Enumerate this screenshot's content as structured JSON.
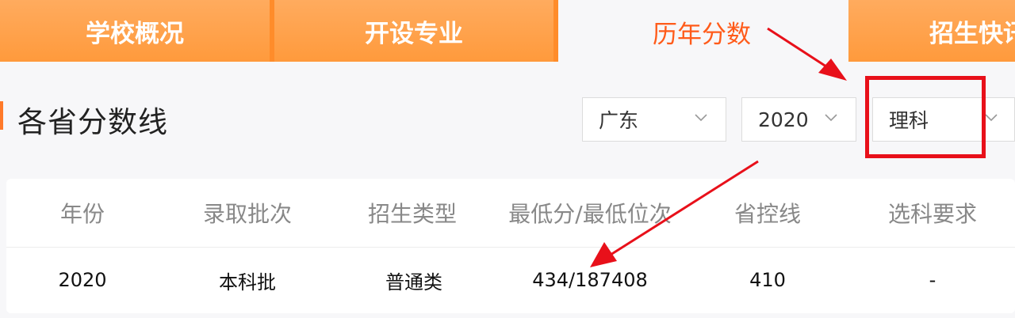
{
  "tabs": [
    {
      "label": "学校概况",
      "active": false
    },
    {
      "label": "开设专业",
      "active": false
    },
    {
      "label": "历年分数",
      "active": true
    },
    {
      "label": "招生快讯",
      "active": false
    }
  ],
  "section": {
    "title": "各省分数线"
  },
  "filters": {
    "province": "广东",
    "year": "2020",
    "subject": "理科"
  },
  "table": {
    "headers": [
      "年份",
      "录取批次",
      "招生类型",
      "最低分/最低位次",
      "省控线",
      "选科要求"
    ],
    "rows": [
      [
        "2020",
        "本科批",
        "普通类",
        "434/187408",
        "410",
        "-"
      ]
    ]
  },
  "colors": {
    "tab_bg": "#ff9a3c",
    "active_tab_text": "#ff5b1a",
    "annotation_red": "#e8101a"
  },
  "icons": {
    "dropdown": "chevron-down-icon"
  }
}
